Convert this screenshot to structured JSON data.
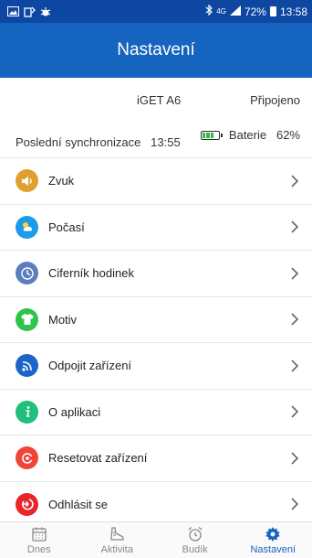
{
  "status_bar": {
    "battery": "72%",
    "time": "13:58",
    "signal": "4G"
  },
  "header": {
    "title": "Nastavení"
  },
  "device": {
    "name": "iGET A6",
    "connection_status": "Připojeno",
    "last_sync_label": "Poslední synchronizace",
    "last_sync_time": "13:55",
    "battery_label": "Baterie",
    "battery_value": "62%",
    "battery_color": "#3ab54a"
  },
  "menu": [
    {
      "label": "Zvuk",
      "icon": "speaker-icon",
      "color": "#e0a030"
    },
    {
      "label": "Počasí",
      "icon": "weather-icon",
      "color": "#1e9be8"
    },
    {
      "label": "Ciferník hodinek",
      "icon": "clock-icon",
      "color": "#5b7fbd"
    },
    {
      "label": "Motiv",
      "icon": "tshirt-icon",
      "color": "#2ec44a"
    },
    {
      "label": "Odpojit zařízení",
      "icon": "wireless-icon",
      "color": "#1d63c9"
    },
    {
      "label": "O aplikaci",
      "icon": "info-icon",
      "color": "#1ec07a"
    },
    {
      "label": "Resetovat zařízení",
      "icon": "reset-icon",
      "color": "#f04438"
    },
    {
      "label": "Odhlásit se",
      "icon": "logout-icon",
      "color": "#e8252a"
    }
  ],
  "tabs": [
    {
      "label": "Dnes",
      "icon": "calendar-icon",
      "active": false
    },
    {
      "label": "Aktivita",
      "icon": "shoe-icon",
      "active": false
    },
    {
      "label": "Budík",
      "icon": "alarm-clock-icon",
      "active": false
    },
    {
      "label": "Nastavení",
      "icon": "gear-icon",
      "active": true
    }
  ],
  "colors": {
    "status_bar": "#0d47a1",
    "header": "#1565c0",
    "active_tab": "#1565c0"
  }
}
